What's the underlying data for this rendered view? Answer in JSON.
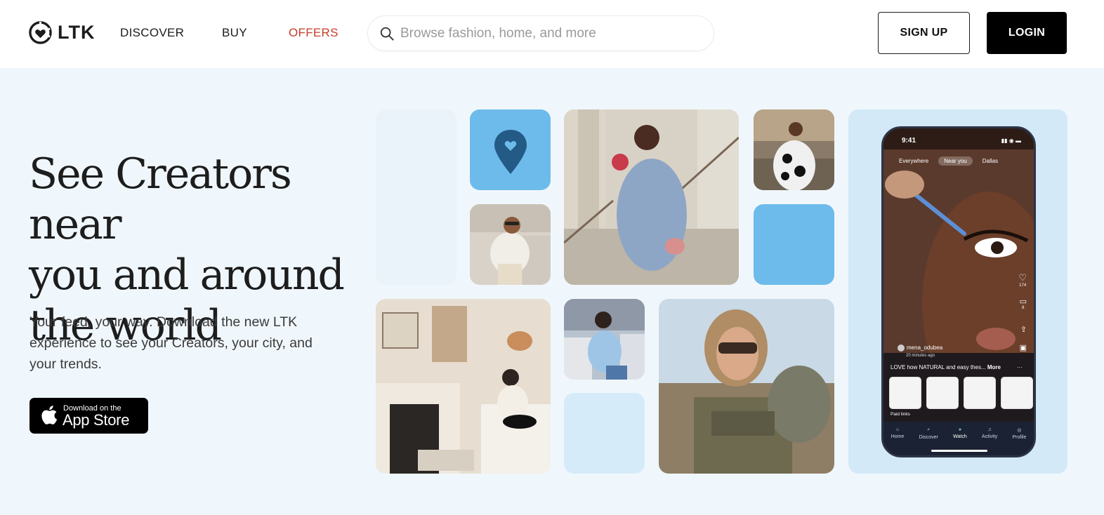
{
  "header": {
    "logo_text": "LTK",
    "nav": [
      {
        "label": "DISCOVER"
      },
      {
        "label": "BUY"
      },
      {
        "label": "OFFERS"
      }
    ],
    "search": {
      "placeholder": "Browse fashion, home, and more"
    },
    "signup_label": "SIGN UP",
    "login_label": "LOGIN"
  },
  "hero": {
    "title_line1": "See Creators near",
    "title_line2": "you and around",
    "title_line3": "the world",
    "subtitle_line1": "Your feed, your way. Download the new LTK",
    "subtitle_line2": "experience to see your Creators, your city, and",
    "subtitle_line3": "your trends.",
    "appstore_small": "Download on the",
    "appstore_big": "App Store"
  },
  "phone": {
    "time": "9:41",
    "tabs": [
      "Everywhere",
      "Near you",
      "Dallas"
    ],
    "likes": "174",
    "comments": "8",
    "username": "mena_odubea",
    "time_ago": "20 minutes ago",
    "caption": "LOVE how NATURAL and easy thes...",
    "caption_more": "More",
    "paid_links": "Paid links",
    "nav": [
      "Home",
      "Discover",
      "Watch",
      "Activity",
      "Profile"
    ]
  },
  "colors": {
    "accent_offers": "#c43d2b",
    "tile_blue": "#6dbbea",
    "tile_pale": "#d6ebf9",
    "hero_bg": "#f0f7fc"
  }
}
